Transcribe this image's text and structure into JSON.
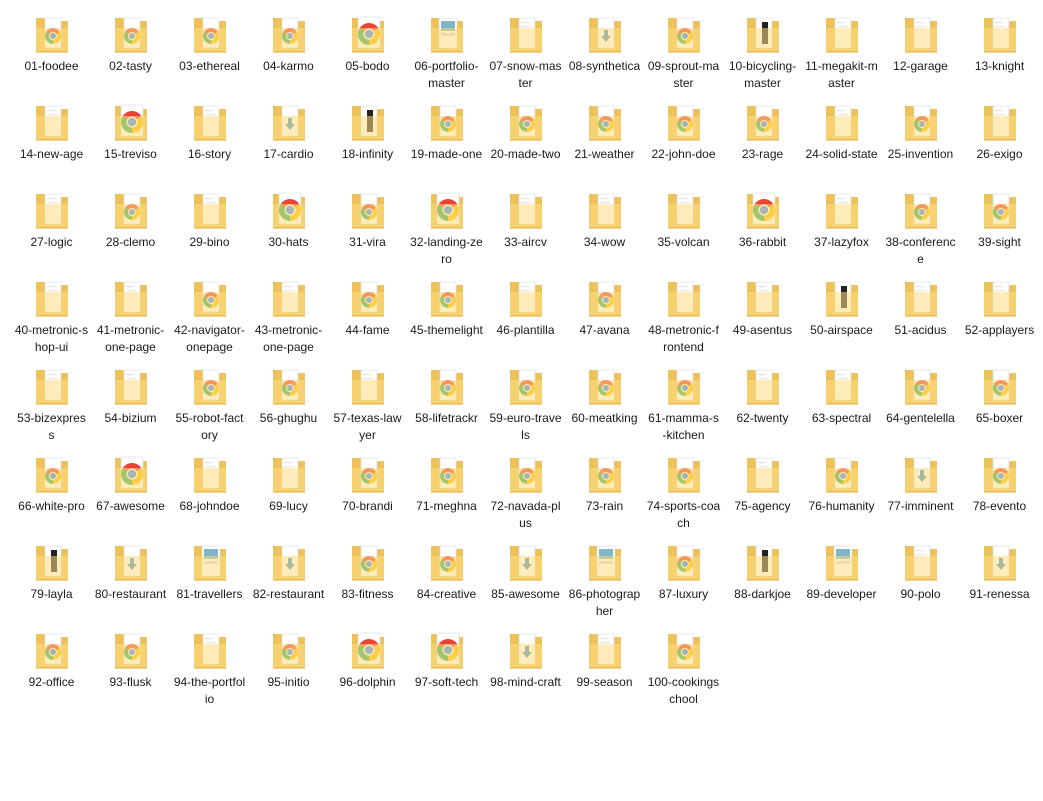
{
  "window": {
    "title": ""
  },
  "colors": {
    "folder_back": "#eec25a",
    "folder_front": "#ffdc82",
    "doc": "#ffffff"
  },
  "items": [
    {
      "label": "01-foodee",
      "icon": "chrome"
    },
    {
      "label": "02-tasty",
      "icon": "chrome"
    },
    {
      "label": "03-ethereal",
      "icon": "chrome"
    },
    {
      "label": "04-karmo",
      "icon": "chrome"
    },
    {
      "label": "05-bodo",
      "icon": "chrome-large"
    },
    {
      "label": "06-portfolio-master",
      "icon": "image-preview"
    },
    {
      "label": "07-snow-master",
      "icon": "blank"
    },
    {
      "label": "08-synthetica",
      "icon": "download"
    },
    {
      "label": "09-sprout-master",
      "icon": "chrome"
    },
    {
      "label": "10-bicycling-master",
      "icon": "dark-preview"
    },
    {
      "label": "11-megakit-master",
      "icon": "blank"
    },
    {
      "label": "12-garage",
      "icon": "blank"
    },
    {
      "label": "13-knight",
      "icon": "blank"
    },
    {
      "label": "14-new-age",
      "icon": "blank"
    },
    {
      "label": "15-treviso",
      "icon": "chrome-large"
    },
    {
      "label": "16-story",
      "icon": "blank"
    },
    {
      "label": "17-cardio",
      "icon": "download"
    },
    {
      "label": "18-infinity",
      "icon": "dark-preview"
    },
    {
      "label": "19-made-one",
      "icon": "chrome"
    },
    {
      "label": "20-made-two",
      "icon": "chrome"
    },
    {
      "label": "21-weather",
      "icon": "chrome"
    },
    {
      "label": "22-john-doe",
      "icon": "chrome"
    },
    {
      "label": "23-rage",
      "icon": "chrome"
    },
    {
      "label": "24-solid-state",
      "icon": "blank"
    },
    {
      "label": "25-invention",
      "icon": "chrome"
    },
    {
      "label": "26-exigo",
      "icon": "blank"
    },
    {
      "label": "27-logic",
      "icon": "blank"
    },
    {
      "label": "28-clemo",
      "icon": "chrome"
    },
    {
      "label": "29-bino",
      "icon": "blank"
    },
    {
      "label": "30-hats",
      "icon": "chrome-large"
    },
    {
      "label": "31-vira",
      "icon": "chrome"
    },
    {
      "label": "32-landing-zero",
      "icon": "chrome-large"
    },
    {
      "label": "33-aircv",
      "icon": "blank"
    },
    {
      "label": "34-wow",
      "icon": "blank"
    },
    {
      "label": "35-volcan",
      "icon": "blank"
    },
    {
      "label": "36-rabbit",
      "icon": "chrome-large"
    },
    {
      "label": "37-lazyfox",
      "icon": "blank"
    },
    {
      "label": "38-conference",
      "icon": "chrome"
    },
    {
      "label": "39-sight",
      "icon": "chrome"
    },
    {
      "label": "40-metronic-shop-ui",
      "icon": "blank"
    },
    {
      "label": "41-metronic-one-page",
      "icon": "blank"
    },
    {
      "label": "42-navigator-onepage",
      "icon": "chrome"
    },
    {
      "label": "43-metronic-one-page",
      "icon": "blank"
    },
    {
      "label": "44-fame",
      "icon": "chrome"
    },
    {
      "label": "45-themelight",
      "icon": "chrome"
    },
    {
      "label": "46-plantilla",
      "icon": "blank"
    },
    {
      "label": "47-avana",
      "icon": "chrome"
    },
    {
      "label": "48-metronic-frontend",
      "icon": "blank"
    },
    {
      "label": "49-asentus",
      "icon": "blank"
    },
    {
      "label": "50-airspace",
      "icon": "dark-preview"
    },
    {
      "label": "51-acidus",
      "icon": "blank"
    },
    {
      "label": "52-applayers",
      "icon": "blank"
    },
    {
      "label": "53-bizexpress",
      "icon": "blank"
    },
    {
      "label": "54-bizium",
      "icon": "blank"
    },
    {
      "label": "55-robot-factory",
      "icon": "chrome"
    },
    {
      "label": "56-ghughu",
      "icon": "chrome"
    },
    {
      "label": "57-texas-lawyer",
      "icon": "blank"
    },
    {
      "label": "58-lifetrackr",
      "icon": "chrome"
    },
    {
      "label": "59-euro-travels",
      "icon": "chrome"
    },
    {
      "label": "60-meatking",
      "icon": "chrome"
    },
    {
      "label": "61-mamma-s-kitchen",
      "icon": "chrome"
    },
    {
      "label": "62-twenty",
      "icon": "blank"
    },
    {
      "label": "63-spectral",
      "icon": "blank"
    },
    {
      "label": "64-gentelella",
      "icon": "chrome"
    },
    {
      "label": "65-boxer",
      "icon": "chrome"
    },
    {
      "label": "66-white-pro",
      "icon": "chrome"
    },
    {
      "label": "67-awesome",
      "icon": "chrome-large"
    },
    {
      "label": "68-johndoe",
      "icon": "blank"
    },
    {
      "label": "69-lucy",
      "icon": "blank"
    },
    {
      "label": "70-brandi",
      "icon": "chrome"
    },
    {
      "label": "71-meghna",
      "icon": "chrome"
    },
    {
      "label": "72-navada-plus",
      "icon": "chrome"
    },
    {
      "label": "73-rain",
      "icon": "chrome"
    },
    {
      "label": "74-sports-coach",
      "icon": "chrome"
    },
    {
      "label": "75-agency",
      "icon": "blank"
    },
    {
      "label": "76-humanity",
      "icon": "chrome"
    },
    {
      "label": "77-imminent",
      "icon": "download"
    },
    {
      "label": "78-evento",
      "icon": "chrome"
    },
    {
      "label": "79-layla",
      "icon": "dark-preview"
    },
    {
      "label": "80-restaurant",
      "icon": "download"
    },
    {
      "label": "81-travellers",
      "icon": "image-preview"
    },
    {
      "label": "82-restaurant",
      "icon": "download"
    },
    {
      "label": "83-fitness",
      "icon": "chrome"
    },
    {
      "label": "84-creative",
      "icon": "chrome"
    },
    {
      "label": "85-awesome",
      "icon": "download"
    },
    {
      "label": "86-photographer",
      "icon": "image-preview"
    },
    {
      "label": "87-luxury",
      "icon": "chrome"
    },
    {
      "label": "88-darkjoe",
      "icon": "dark-preview"
    },
    {
      "label": "89-developer",
      "icon": "image-preview"
    },
    {
      "label": "90-polo",
      "icon": "blank"
    },
    {
      "label": "91-renessa",
      "icon": "download"
    },
    {
      "label": "92-office",
      "icon": "chrome"
    },
    {
      "label": "93-flusk",
      "icon": "chrome"
    },
    {
      "label": "94-the-portfolio",
      "icon": "blank"
    },
    {
      "label": "95-initio",
      "icon": "chrome"
    },
    {
      "label": "96-dolphin",
      "icon": "chrome-large"
    },
    {
      "label": "97-soft-tech",
      "icon": "chrome-large"
    },
    {
      "label": "98-mind-craft",
      "icon": "download"
    },
    {
      "label": "99-season",
      "icon": "blank"
    },
    {
      "label": "100-cookingschool",
      "icon": "chrome"
    }
  ]
}
